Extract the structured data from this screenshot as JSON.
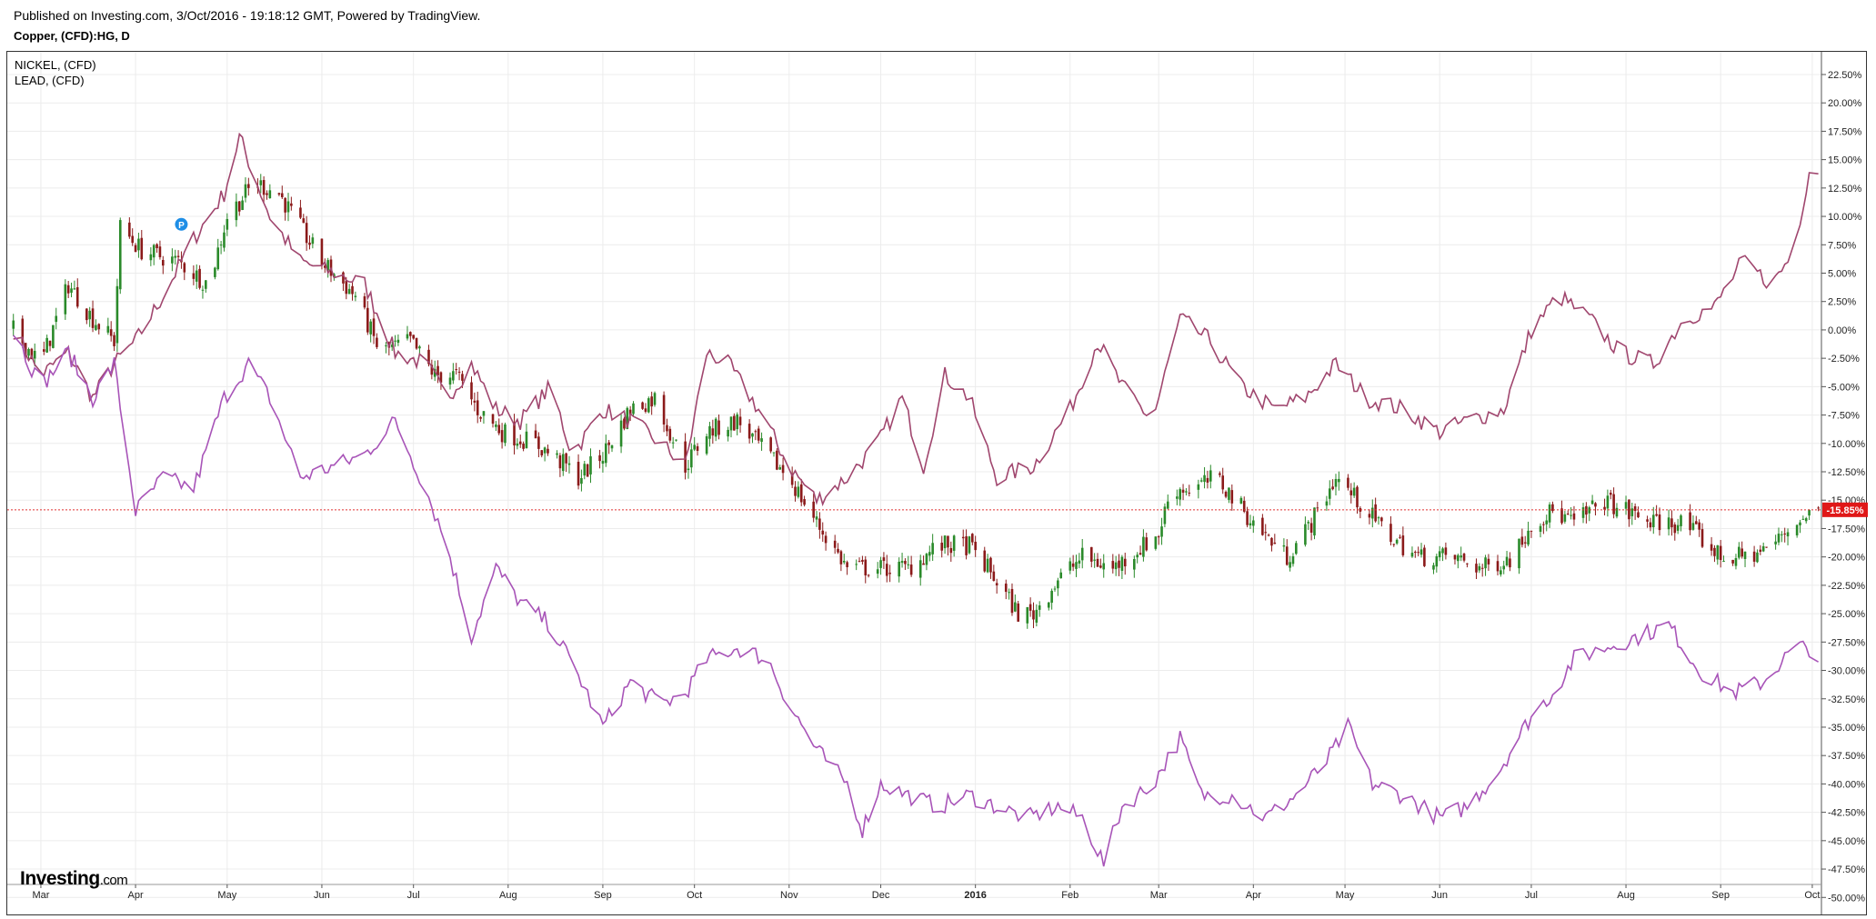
{
  "header": {
    "published": "Published on Investing.com, 3/Oct/2016 - 19:18:12 GMT, Powered by TradingView.",
    "symbol": "Copper, (CFD):HG, D"
  },
  "legend": [
    "NICKEL,  (CFD)",
    "LEAD,  (CFD)"
  ],
  "logo": {
    "brand": "Investing",
    "domain": ".com"
  },
  "colors": {
    "nickel": "#a0466e",
    "lead": "#a854b8",
    "candle_up": "#2a8a2a",
    "candle_down": "#8b1a1a",
    "last_price_line": "#e03030",
    "last_price_badge": "#e01818",
    "grid": "#ececec"
  },
  "chart_data": {
    "type": "candlestick+line",
    "scale": "percent",
    "ylim": [
      -51.5,
      24.5
    ],
    "ytick_labels": [
      "22.50%",
      "20.00%",
      "17.50%",
      "15.00%",
      "12.50%",
      "10.00%",
      "7.50%",
      "5.00%",
      "2.50%",
      "0.00%",
      "-2.50%",
      "-5.00%",
      "-7.50%",
      "-10.00%",
      "-12.50%",
      "-15.00%",
      "-17.50%",
      "-20.00%",
      "-22.50%",
      "-25.00%",
      "-27.50%",
      "-30.00%",
      "-32.50%",
      "-35.00%",
      "-37.50%",
      "-40.00%",
      "-42.50%",
      "-45.00%",
      "-47.50%",
      "-50.00%"
    ],
    "xlim": [
      "2015-02-18",
      "2016-10-04"
    ],
    "x_ticks": [
      {
        "label": "Mar",
        "date": "2015-03-01"
      },
      {
        "label": "Apr",
        "date": "2015-04-01"
      },
      {
        "label": "May",
        "date": "2015-05-01"
      },
      {
        "label": "Jun",
        "date": "2015-06-01"
      },
      {
        "label": "Jul",
        "date": "2015-07-01"
      },
      {
        "label": "Aug",
        "date": "2015-08-01"
      },
      {
        "label": "Sep",
        "date": "2015-09-01"
      },
      {
        "label": "Oct",
        "date": "2015-10-01"
      },
      {
        "label": "Nov",
        "date": "2015-11-01"
      },
      {
        "label": "Dec",
        "date": "2015-12-01"
      },
      {
        "label": "2016",
        "date": "2016-01-01",
        "bold": true
      },
      {
        "label": "Feb",
        "date": "2016-02-01"
      },
      {
        "label": "Mar",
        "date": "2016-03-01"
      },
      {
        "label": "Apr",
        "date": "2016-04-01"
      },
      {
        "label": "May",
        "date": "2016-05-01"
      },
      {
        "label": "Jun",
        "date": "2016-06-01"
      },
      {
        "label": "Jul",
        "date": "2016-07-01"
      },
      {
        "label": "Aug",
        "date": "2016-08-01"
      },
      {
        "label": "Sep",
        "date": "2016-09-01"
      },
      {
        "label": "Oct",
        "date": "2016-10-01"
      }
    ],
    "last_value": -15.85,
    "last_value_label": "-15.85%",
    "series": [
      {
        "name": "Copper, (CFD):HG, D",
        "kind": "candles",
        "points": [
          [
            "2015-02-20",
            0
          ],
          [
            "2015-03-01",
            -3
          ],
          [
            "2015-03-10",
            4
          ],
          [
            "2015-03-18",
            1
          ],
          [
            "2015-03-25",
            -1
          ],
          [
            "2015-03-27",
            9
          ],
          [
            "2015-04-03",
            7
          ],
          [
            "2015-04-15",
            6
          ],
          [
            "2015-04-25",
            4
          ],
          [
            "2015-05-01",
            10
          ],
          [
            "2015-05-10",
            13
          ],
          [
            "2015-05-18",
            12
          ],
          [
            "2015-06-01",
            6
          ],
          [
            "2015-06-12",
            3
          ],
          [
            "2015-06-20",
            -2
          ],
          [
            "2015-06-30",
            -1
          ],
          [
            "2015-07-08",
            -4
          ],
          [
            "2015-07-15",
            -4
          ],
          [
            "2015-07-22",
            -7
          ],
          [
            "2015-07-30",
            -9
          ],
          [
            "2015-08-10",
            -10
          ],
          [
            "2015-08-20",
            -12
          ],
          [
            "2015-08-24",
            -13
          ],
          [
            "2015-09-01",
            -11
          ],
          [
            "2015-09-10",
            -7
          ],
          [
            "2015-09-18",
            -6
          ],
          [
            "2015-09-28",
            -12
          ],
          [
            "2015-10-05",
            -9
          ],
          [
            "2015-10-15",
            -8
          ],
          [
            "2015-10-25",
            -11
          ],
          [
            "2015-11-01",
            -13
          ],
          [
            "2015-11-10",
            -17
          ],
          [
            "2015-11-20",
            -21
          ],
          [
            "2015-11-30",
            -21
          ],
          [
            "2015-12-10",
            -21
          ],
          [
            "2015-12-20",
            -19
          ],
          [
            "2015-12-30",
            -19
          ],
          [
            "2016-01-05",
            -21
          ],
          [
            "2016-01-15",
            -25
          ],
          [
            "2016-01-20",
            -25
          ],
          [
            "2016-01-28",
            -22
          ],
          [
            "2016-02-05",
            -20
          ],
          [
            "2016-02-15",
            -21
          ],
          [
            "2016-02-25",
            -19
          ],
          [
            "2016-03-01",
            -18
          ],
          [
            "2016-03-05",
            -14
          ],
          [
            "2016-03-12",
            -14
          ],
          [
            "2016-03-20",
            -13
          ],
          [
            "2016-04-01",
            -17
          ],
          [
            "2016-04-12",
            -20
          ],
          [
            "2016-04-20",
            -17
          ],
          [
            "2016-04-28",
            -13
          ],
          [
            "2016-05-05",
            -15
          ],
          [
            "2016-05-15",
            -18
          ],
          [
            "2016-05-25",
            -20
          ],
          [
            "2016-06-05",
            -20
          ],
          [
            "2016-06-15",
            -21
          ],
          [
            "2016-06-25",
            -20
          ],
          [
            "2016-07-01",
            -17
          ],
          [
            "2016-07-08",
            -16
          ],
          [
            "2016-07-15",
            -17
          ],
          [
            "2016-07-25",
            -15
          ],
          [
            "2016-08-01",
            -16
          ],
          [
            "2016-08-10",
            -17
          ],
          [
            "2016-08-20",
            -17
          ],
          [
            "2016-09-01",
            -20
          ],
          [
            "2016-09-10",
            -20
          ],
          [
            "2016-09-18",
            -19
          ],
          [
            "2016-09-25",
            -17
          ],
          [
            "2016-10-03",
            -15.85
          ]
        ]
      },
      {
        "name": "NICKEL,  (CFD)",
        "kind": "line",
        "color": "#a0466e",
        "points": [
          [
            "2015-02-20",
            0
          ],
          [
            "2015-03-01",
            -4
          ],
          [
            "2015-03-10",
            -2
          ],
          [
            "2015-03-18",
            -6
          ],
          [
            "2015-03-25",
            -3
          ],
          [
            "2015-04-01",
            -1
          ],
          [
            "2015-04-10",
            3
          ],
          [
            "2015-04-20",
            8
          ],
          [
            "2015-04-30",
            12
          ],
          [
            "2015-05-05",
            17
          ],
          [
            "2015-05-15",
            10
          ],
          [
            "2015-05-25",
            6
          ],
          [
            "2015-06-05",
            5
          ],
          [
            "2015-06-15",
            4
          ],
          [
            "2015-06-25",
            -2
          ],
          [
            "2015-07-05",
            -3
          ],
          [
            "2015-07-12",
            -6
          ],
          [
            "2015-07-20",
            -3
          ],
          [
            "2015-07-28",
            -7
          ],
          [
            "2015-08-05",
            -8
          ],
          [
            "2015-08-15",
            -5
          ],
          [
            "2015-08-22",
            -11
          ],
          [
            "2015-09-01",
            -7
          ],
          [
            "2015-09-10",
            -8
          ],
          [
            "2015-09-20",
            -10
          ],
          [
            "2015-09-28",
            -12
          ],
          [
            "2015-10-05",
            -2
          ],
          [
            "2015-10-12",
            -3
          ],
          [
            "2015-10-22",
            -7
          ],
          [
            "2015-11-01",
            -12
          ],
          [
            "2015-11-10",
            -15
          ],
          [
            "2015-11-20",
            -13
          ],
          [
            "2015-11-30",
            -10
          ],
          [
            "2015-12-08",
            -6
          ],
          [
            "2015-12-15",
            -12
          ],
          [
            "2015-12-22",
            -4
          ],
          [
            "2015-12-30",
            -6
          ],
          [
            "2016-01-08",
            -13
          ],
          [
            "2016-01-20",
            -12
          ],
          [
            "2016-02-01",
            -7
          ],
          [
            "2016-02-10",
            -1
          ],
          [
            "2016-02-18",
            -5
          ],
          [
            "2016-02-28",
            -8
          ],
          [
            "2016-03-08",
            1
          ],
          [
            "2016-03-18",
            -1
          ],
          [
            "2016-03-28",
            -5
          ],
          [
            "2016-04-08",
            -7
          ],
          [
            "2016-04-18",
            -6
          ],
          [
            "2016-04-28",
            -3
          ],
          [
            "2016-05-08",
            -6
          ],
          [
            "2016-05-20",
            -7
          ],
          [
            "2016-06-01",
            -9
          ],
          [
            "2016-06-10",
            -8
          ],
          [
            "2016-06-22",
            -7
          ],
          [
            "2016-07-01",
            0
          ],
          [
            "2016-07-10",
            3
          ],
          [
            "2016-07-20",
            1
          ],
          [
            "2016-07-30",
            -2
          ],
          [
            "2016-08-10",
            -3
          ],
          [
            "2016-08-20",
            1
          ],
          [
            "2016-08-30",
            2
          ],
          [
            "2016-09-08",
            6
          ],
          [
            "2016-09-18",
            4
          ],
          [
            "2016-09-25",
            7
          ],
          [
            "2016-10-01",
            15.5
          ],
          [
            "2016-10-03",
            14
          ]
        ]
      },
      {
        "name": "LEAD,  (CFD)",
        "kind": "line",
        "color": "#a854b8",
        "points": [
          [
            "2015-02-20",
            0
          ],
          [
            "2015-03-01",
            -5
          ],
          [
            "2015-03-10",
            -2
          ],
          [
            "2015-03-18",
            -6
          ],
          [
            "2015-03-25",
            -3
          ],
          [
            "2015-04-01",
            -16
          ],
          [
            "2015-04-10",
            -13
          ],
          [
            "2015-04-20",
            -14
          ],
          [
            "2015-04-30",
            -6
          ],
          [
            "2015-05-08",
            -3
          ],
          [
            "2015-05-15",
            -6
          ],
          [
            "2015-05-25",
            -13
          ],
          [
            "2015-06-05",
            -12
          ],
          [
            "2015-06-15",
            -11
          ],
          [
            "2015-06-25",
            -8
          ],
          [
            "2015-07-05",
            -14
          ],
          [
            "2015-07-12",
            -19
          ],
          [
            "2015-07-20",
            -27
          ],
          [
            "2015-07-28",
            -21
          ],
          [
            "2015-08-05",
            -24
          ],
          [
            "2015-08-15",
            -26
          ],
          [
            "2015-08-25",
            -31
          ],
          [
            "2015-09-01",
            -35
          ],
          [
            "2015-09-10",
            -31
          ],
          [
            "2015-09-20",
            -33
          ],
          [
            "2015-09-28",
            -32
          ],
          [
            "2015-10-05",
            -29
          ],
          [
            "2015-10-15",
            -28
          ],
          [
            "2015-10-25",
            -29
          ],
          [
            "2015-11-01",
            -33
          ],
          [
            "2015-11-10",
            -37
          ],
          [
            "2015-11-20",
            -40
          ],
          [
            "2015-11-25",
            -44
          ],
          [
            "2015-12-01",
            -40
          ],
          [
            "2015-12-10",
            -41
          ],
          [
            "2015-12-20",
            -42
          ],
          [
            "2015-12-30",
            -41
          ],
          [
            "2016-01-08",
            -42
          ],
          [
            "2016-01-18",
            -43
          ],
          [
            "2016-01-28",
            -42
          ],
          [
            "2016-02-05",
            -43
          ],
          [
            "2016-02-12",
            -47
          ],
          [
            "2016-02-18",
            -42
          ],
          [
            "2016-02-28",
            -40
          ],
          [
            "2016-03-08",
            -36
          ],
          [
            "2016-03-15",
            -41
          ],
          [
            "2016-03-25",
            -41
          ],
          [
            "2016-04-05",
            -43
          ],
          [
            "2016-04-15",
            -41
          ],
          [
            "2016-04-25",
            -38
          ],
          [
            "2016-05-02",
            -35
          ],
          [
            "2016-05-10",
            -40
          ],
          [
            "2016-05-20",
            -41
          ],
          [
            "2016-06-01",
            -43
          ],
          [
            "2016-06-10",
            -42
          ],
          [
            "2016-06-20",
            -39
          ],
          [
            "2016-07-01",
            -34
          ],
          [
            "2016-07-08",
            -32
          ],
          [
            "2016-07-15",
            -29
          ],
          [
            "2016-07-25",
            -28
          ],
          [
            "2016-08-05",
            -27
          ],
          [
            "2016-08-15",
            -26
          ],
          [
            "2016-08-25",
            -30
          ],
          [
            "2016-09-05",
            -32
          ],
          [
            "2016-09-15",
            -31
          ],
          [
            "2016-09-25",
            -28
          ],
          [
            "2016-10-01",
            -28
          ],
          [
            "2016-10-03",
            -29
          ]
        ]
      }
    ]
  }
}
